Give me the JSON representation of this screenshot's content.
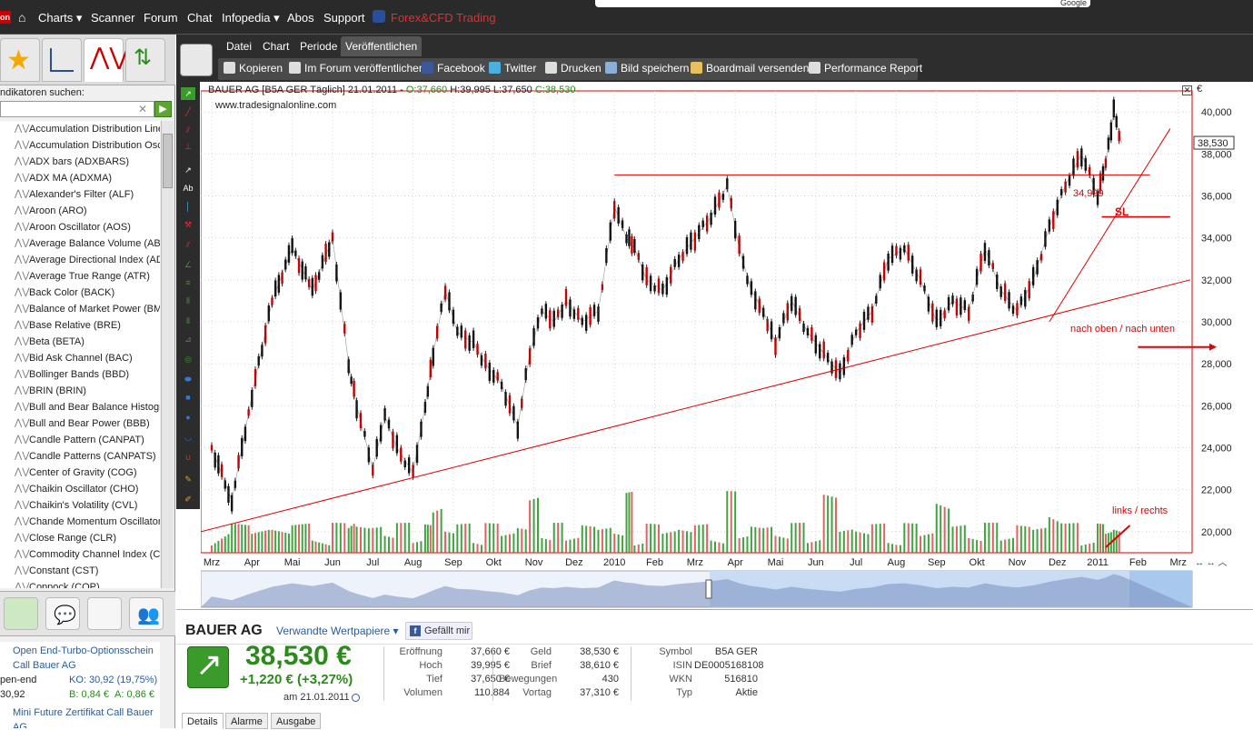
{
  "nav": {
    "logo": "on",
    "items": [
      "Charts ▾",
      "Scanner",
      "Forum",
      "Chat",
      "Infopedia ▾",
      "Abos",
      "Support"
    ],
    "brand": "Forex&CFD Trading",
    "search_hint": "Google"
  },
  "left_panel": {
    "search_label": "ndikatoren suchen:",
    "search_placeholder": "",
    "indicators": [
      "Accumulation Distribution Line",
      "Accumulation Distribution Osc",
      "ADX bars (ADXBARS)",
      "ADX MA (ADXMA)",
      "Alexander's Filter (ALF)",
      "Aroon (ARO)",
      "Aroon Oscillator (AOS)",
      "Average Balance Volume (AB",
      "Average Directional Index (AD",
      "Average True Range (ATR)",
      "Back Color (BACK)",
      "Balance of Market Power (BM",
      "Base Relative (BRE)",
      "Beta (BETA)",
      "Bid Ask Channel (BAC)",
      "Bollinger Bands (BBD)",
      "BRIN (BRIN)",
      "Bull and Bear Balance Histogr",
      "Bull and Bear Power (BBB)",
      "Candle Pattern (CANPAT)",
      "Candle Patterns (CANPATS)",
      "Center of Gravity (COG)",
      "Chaikin Oscillator (CHO)",
      "Chaikin's Volatility (CVL)",
      "Chande Momentum Oscillator (",
      "Close Range (CLR)",
      "Commodity Channel Index (CC",
      "Constant (CST)",
      "Coppock (COP)"
    ],
    "news": [
      {
        "title": "Open End-Turbo-Optionsschein",
        "sub": "Call Bauer AG",
        "a": "pen-end",
        "b": "KO: 30,92 (19,75%)",
        "c": "30,92",
        "d": "B: 0,84 €",
        "e": "A: 0,86 €"
      },
      {
        "title": "Mini Future Zertifikat Call Bauer",
        "sub": "AG"
      }
    ]
  },
  "app": {
    "menus": [
      "Datei",
      "Chart",
      "Periode",
      "Veröffentlichen"
    ],
    "active_menu": "Veröffentlichen",
    "publish_actions": [
      "Kopieren",
      "Im Forum veröffentlichen",
      "Facebook",
      "Twitter",
      "Drucken",
      "Bild speichern",
      "Boardmail versenden",
      "Performance Report"
    ]
  },
  "chart_header": {
    "symbol": "BAUER AG [B5A GER  Täglich] 21.01.2011 - ",
    "o": "O:37,660",
    "h": "H:39,995",
    "l": "L:37,650",
    "c": "C:38,530",
    "source": "www.tradesignalonline.com",
    "currency": "€"
  },
  "annotations": {
    "sl_value": "34,999",
    "sl": "SL",
    "up_down": "nach oben / nach unten",
    "left_right": "links / rechts"
  },
  "chart_data": {
    "type": "line",
    "title": "BAUER AG [B5A GER  Täglich]",
    "ylim": [
      19000,
      41000
    ],
    "y_ticks": [
      "40,000",
      "38,000",
      "36,000",
      "34,000",
      "32,000",
      "30,000",
      "28,000",
      "26,000",
      "24,000",
      "22,000",
      "20,000"
    ],
    "y_tick_values": [
      40000,
      38000,
      36000,
      34000,
      32000,
      30000,
      28000,
      26000,
      24000,
      22000,
      20000
    ],
    "x_labels": [
      "Mrz",
      "Apr",
      "Mai",
      "Jun",
      "Jul",
      "Aug",
      "Sep",
      "Okt",
      "Nov",
      "Dez",
      "2010",
      "Feb",
      "Mrz",
      "Apr",
      "Mai",
      "Jun",
      "Jul",
      "Aug",
      "Sep",
      "Okt",
      "Nov",
      "Dez",
      "2011",
      "Feb",
      "Mrz"
    ],
    "last_price_label": "38,530",
    "x_month_index": [
      0,
      1,
      2,
      3,
      4,
      5,
      6,
      7,
      8,
      9,
      10,
      11,
      12,
      13,
      14,
      15,
      16,
      17,
      18,
      19,
      20,
      21,
      22,
      23,
      24
    ],
    "series": [
      {
        "name": "BAUER AG",
        "x_month": [
          0,
          0.5,
          1,
          1.5,
          2,
          2.5,
          3,
          3.4,
          3.6,
          4,
          4.3,
          4.6,
          5,
          5.3,
          5.5,
          5.8,
          6.1,
          6.5,
          6.8,
          7.2,
          7.6,
          7.9,
          8.2,
          8.5,
          8.8,
          9.2,
          9.6,
          10,
          10.3,
          10.5,
          10.8,
          11.2,
          11.6,
          12,
          12.4,
          12.8,
          13.1,
          13.4,
          13.7,
          14,
          14.4,
          14.8,
          15.2,
          15.6,
          16,
          16.4,
          16.8,
          17.2,
          17.6,
          18,
          18.4,
          18.8,
          19.2,
          19.6,
          20,
          20.4,
          20.8,
          21.2,
          21.6,
          22,
          22.2,
          22.4,
          22.6
        ],
        "y": [
          24000,
          21500,
          26500,
          31000,
          33500,
          31500,
          34000,
          28000,
          26000,
          23000,
          25500,
          24000,
          22800,
          26000,
          28500,
          31500,
          29500,
          29000,
          28000,
          27000,
          25000,
          28500,
          30500,
          30000,
          31000,
          30000,
          30500,
          35500,
          34000,
          33500,
          32000,
          31500,
          33000,
          34000,
          35000,
          36500,
          33500,
          31500,
          30500,
          29000,
          31000,
          29500,
          28500,
          27500,
          29500,
          30500,
          33000,
          33500,
          32000,
          30000,
          31000,
          30500,
          33500,
          31500,
          30500,
          32000,
          34500,
          36500,
          38000,
          36000,
          37500,
          40000,
          38530
        ]
      }
    ]
  },
  "trendlines": {
    "horizontal_resistance": 37000,
    "sl_level": 35000
  },
  "quote": {
    "name": "BAUER AG",
    "related": "Verwandte Wertpapiere ▾",
    "like": "Gefällt mir",
    "like_icon": "f",
    "price": "38,530 €",
    "change": "+1,220 € (+3,27%)",
    "date": "am 21.01.2011",
    "col1": [
      [
        "Eröffnung",
        "37,660 €"
      ],
      [
        "Hoch",
        "39,995 €"
      ],
      [
        "Tief",
        "37,650 €"
      ],
      [
        "Volumen",
        "110.884"
      ]
    ],
    "col2": [
      [
        "Geld",
        "38,530 €"
      ],
      [
        "Brief",
        "38,610 €"
      ],
      [
        "Bewegungen",
        "430"
      ],
      [
        "Vortag",
        "37,310 €"
      ]
    ],
    "col3": [
      [
        "Symbol",
        "B5A GER"
      ],
      [
        "ISIN",
        "DE0005168108"
      ],
      [
        "WKN",
        "516810"
      ],
      [
        "Typ",
        "Aktie"
      ]
    ],
    "tabs": [
      "Details",
      "Alarme",
      "Ausgabe"
    ]
  },
  "colors": {
    "up": "#2a8a1a",
    "down": "#cc0000",
    "accent": "#e00000"
  }
}
